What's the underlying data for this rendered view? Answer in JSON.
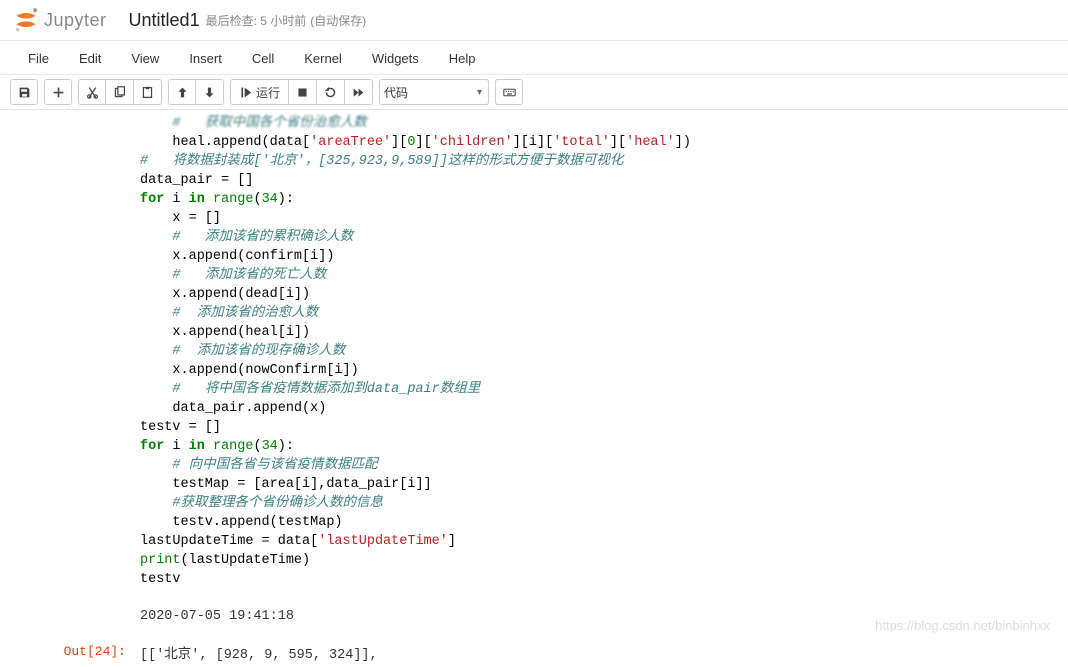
{
  "header": {
    "brand": "Jupyter",
    "title": "Untitled1",
    "checkpoint": "最后检查: 5 小时前",
    "autosave": "(自动保存)"
  },
  "menu": [
    "File",
    "Edit",
    "View",
    "Insert",
    "Cell",
    "Kernel",
    "Widgets",
    "Help"
  ],
  "toolbar": {
    "run_label": "运行",
    "celltype": "代码"
  },
  "code": {
    "lines": [
      {
        "indent": 1,
        "tokens": [
          {
            "t": "cmt",
            "v": "#   获取中国各个省份治愈人数"
          }
        ],
        "blur": true
      },
      {
        "indent": 1,
        "tokens": [
          {
            "t": "p",
            "v": "heal.append(data["
          },
          {
            "t": "str",
            "v": "'areaTree'"
          },
          {
            "t": "p",
            "v": "]["
          },
          {
            "t": "num",
            "v": "0"
          },
          {
            "t": "p",
            "v": "]["
          },
          {
            "t": "str",
            "v": "'children'"
          },
          {
            "t": "p",
            "v": "][i]["
          },
          {
            "t": "str",
            "v": "'total'"
          },
          {
            "t": "p",
            "v": "]["
          },
          {
            "t": "str",
            "v": "'heal'"
          },
          {
            "t": "p",
            "v": "])"
          }
        ]
      },
      {
        "indent": 0,
        "tokens": [
          {
            "t": "cmt",
            "v": "#   将数据封装成['北京'，[325,923,9,589]]这样的形式方便于数据可视化"
          }
        ]
      },
      {
        "indent": 0,
        "tokens": [
          {
            "t": "p",
            "v": "data_pair = []"
          }
        ]
      },
      {
        "indent": 0,
        "tokens": [
          {
            "t": "kw",
            "v": "for"
          },
          {
            "t": "p",
            "v": " i "
          },
          {
            "t": "kw",
            "v": "in"
          },
          {
            "t": "p",
            "v": " "
          },
          {
            "t": "bi",
            "v": "range"
          },
          {
            "t": "p",
            "v": "("
          },
          {
            "t": "num",
            "v": "34"
          },
          {
            "t": "p",
            "v": "):"
          }
        ]
      },
      {
        "indent": 1,
        "tokens": [
          {
            "t": "p",
            "v": "x = []"
          }
        ]
      },
      {
        "indent": 1,
        "tokens": [
          {
            "t": "cmt",
            "v": "#   添加该省的累积确诊人数"
          }
        ]
      },
      {
        "indent": 1,
        "tokens": [
          {
            "t": "p",
            "v": "x.append(confirm[i])"
          }
        ]
      },
      {
        "indent": 1,
        "tokens": [
          {
            "t": "cmt",
            "v": "#   添加该省的死亡人数"
          }
        ]
      },
      {
        "indent": 1,
        "tokens": [
          {
            "t": "p",
            "v": "x.append(dead[i])"
          }
        ]
      },
      {
        "indent": 1,
        "tokens": [
          {
            "t": "cmt",
            "v": "#  添加该省的治愈人数"
          }
        ]
      },
      {
        "indent": 1,
        "tokens": [
          {
            "t": "p",
            "v": "x.append(heal[i])"
          }
        ]
      },
      {
        "indent": 1,
        "tokens": [
          {
            "t": "cmt",
            "v": "#  添加该省的现存确诊人数"
          }
        ]
      },
      {
        "indent": 1,
        "tokens": [
          {
            "t": "p",
            "v": "x.append(nowConfirm[i])"
          }
        ]
      },
      {
        "indent": 1,
        "tokens": [
          {
            "t": "cmt",
            "v": "#   将中国各省疫情数据添加到data_pair数组里"
          }
        ]
      },
      {
        "indent": 1,
        "tokens": [
          {
            "t": "p",
            "v": "data_pair.append(x)"
          }
        ]
      },
      {
        "indent": 0,
        "tokens": [
          {
            "t": "p",
            "v": ""
          }
        ]
      },
      {
        "indent": 0,
        "tokens": [
          {
            "t": "p",
            "v": "testv = []"
          }
        ]
      },
      {
        "indent": 0,
        "tokens": [
          {
            "t": "p",
            "v": ""
          }
        ]
      },
      {
        "indent": 0,
        "tokens": [
          {
            "t": "kw",
            "v": "for"
          },
          {
            "t": "p",
            "v": " i "
          },
          {
            "t": "kw",
            "v": "in"
          },
          {
            "t": "p",
            "v": " "
          },
          {
            "t": "bi",
            "v": "range"
          },
          {
            "t": "p",
            "v": "("
          },
          {
            "t": "num",
            "v": "34"
          },
          {
            "t": "p",
            "v": "):"
          }
        ]
      },
      {
        "indent": 1,
        "tokens": [
          {
            "t": "cmt",
            "v": "# 向中国各省与该省疫情数据匹配"
          }
        ]
      },
      {
        "indent": 1,
        "tokens": [
          {
            "t": "p",
            "v": "testMap = [area[i],data_pair[i]]"
          }
        ]
      },
      {
        "indent": 1,
        "tokens": [
          {
            "t": "cmt",
            "v": "#获取整理各个省份确诊人数的信息"
          }
        ]
      },
      {
        "indent": 1,
        "tokens": [
          {
            "t": "p",
            "v": "testv.append(testMap)"
          }
        ]
      },
      {
        "indent": 0,
        "tokens": [
          {
            "t": "p",
            "v": "lastUpdateTime = data["
          },
          {
            "t": "str",
            "v": "'lastUpdateTime'"
          },
          {
            "t": "p",
            "v": "]"
          }
        ]
      },
      {
        "indent": 0,
        "tokens": [
          {
            "t": "bi",
            "v": "print"
          },
          {
            "t": "p",
            "v": "(lastUpdateTime)"
          }
        ]
      },
      {
        "indent": 0,
        "tokens": [
          {
            "t": "p",
            "v": "testv"
          }
        ]
      }
    ]
  },
  "output": {
    "text1": "2020-07-05 19:41:18",
    "prompt": "Out[24]:",
    "text2": "[['北京', [928, 9, 595, 324]],"
  },
  "watermark": "https://blog.csdn.net/binbinhxx"
}
